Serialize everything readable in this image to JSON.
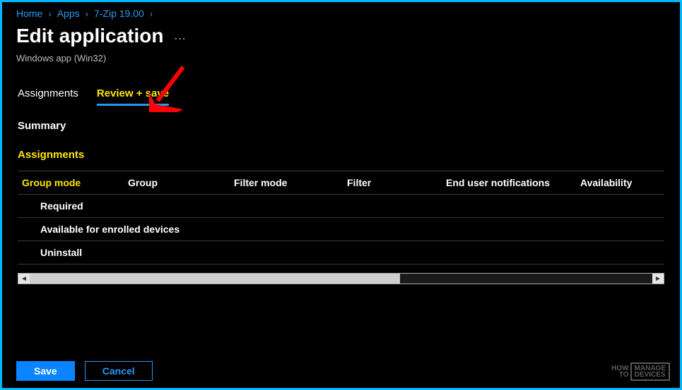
{
  "breadcrumb": {
    "home": "Home",
    "apps": "Apps",
    "appname": "7-Zip 19.00"
  },
  "header": {
    "title": "Edit application",
    "subtitle": "Windows app (Win32)",
    "ellipsis": "…"
  },
  "tabs": {
    "assignments": "Assignments",
    "review_save": "Review + save"
  },
  "summary_label": "Summary",
  "section": {
    "assignments": "Assignments"
  },
  "table": {
    "headers": {
      "group_mode": "Group mode",
      "group": "Group",
      "filter_mode": "Filter mode",
      "filter": "Filter",
      "notifications": "End user notifications",
      "availability": "Availability"
    },
    "rows": [
      {
        "label": "Required"
      },
      {
        "label": "Available for enrolled devices"
      },
      {
        "label": "Uninstall"
      }
    ]
  },
  "footer": {
    "save": "Save",
    "cancel": "Cancel"
  },
  "watermark": {
    "l1": "HOW",
    "l2": "TO",
    "r1": "MANAGE",
    "r2": "DEVICES"
  }
}
